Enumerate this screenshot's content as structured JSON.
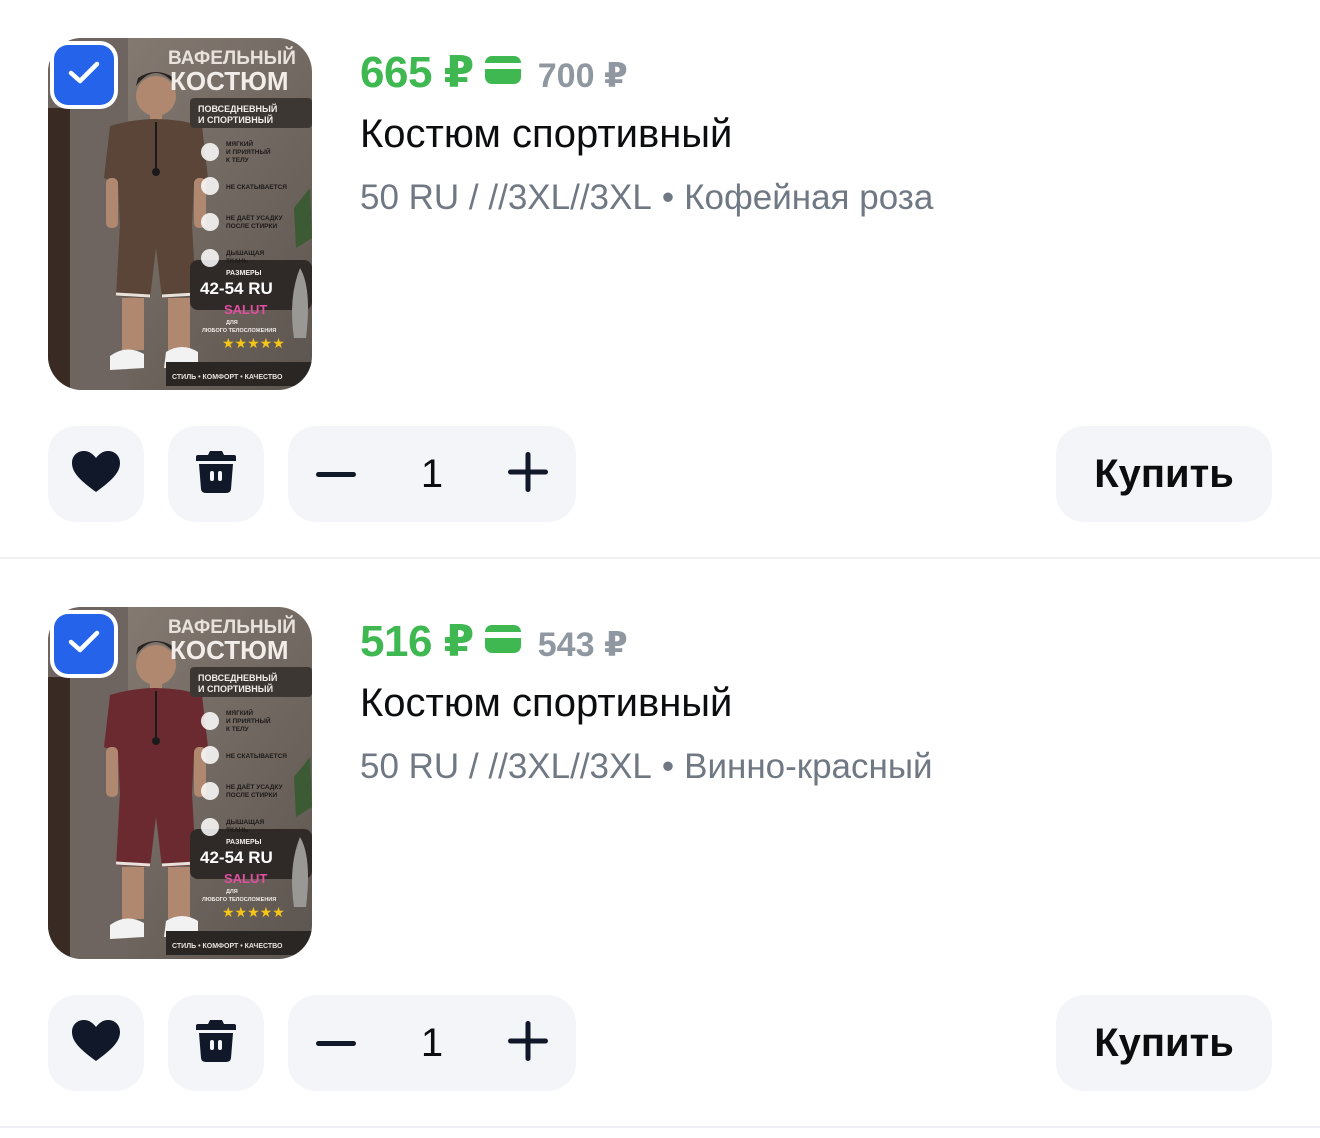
{
  "items": [
    {
      "checked": true,
      "price_current": "665 ₽",
      "price_old": "700 ₽",
      "title": "Костюм спортивный",
      "size": "50 RU / //3XL//3XL",
      "color_name": "Кофейная роза",
      "quantity": "1",
      "buy_label": "Купить",
      "suit_color": "#5a4538",
      "image_text": {
        "headline_1": "ВАФЕЛЬНЫЙ",
        "headline_2": "КОСТЮМ",
        "subtitle_1": "ПОВСЕДНЕВНЫЙ",
        "subtitle_2": "И СПОРТИВНЫЙ",
        "f1a": "МЯГКИЙ",
        "f1b": "И ПРИЯТНЫЙ",
        "f1c": "К ТЕЛУ",
        "f2": "НЕ СКАТЫВАЕТСЯ",
        "f3a": "НЕ ДАЁТ УСАДКУ",
        "f3b": "ПОСЛЕ СТИРКИ",
        "f4a": "ДЫШАЩАЯ",
        "f4b": "ТКАНЬ",
        "sizes_label": "РАЗМЕРЫ",
        "sizes_value": "42-54 RU",
        "brand": "SALUT",
        "for_any_1": "ДЛЯ",
        "for_any_2": "ЛЮБОГО ТЕЛОСЛОЖЕНИЯ",
        "bottom": "СТИЛЬ • КОМФОРТ • КАЧЕСТВО"
      }
    },
    {
      "checked": true,
      "price_current": "516 ₽",
      "price_old": "543 ₽",
      "title": "Костюм спортивный",
      "size": "50 RU / //3XL//3XL",
      "color_name": "Винно-красный",
      "quantity": "1",
      "buy_label": "Купить",
      "suit_color": "#6b2a30",
      "image_text": {
        "headline_1": "ВАФЕЛЬНЫЙ",
        "headline_2": "КОСТЮМ",
        "subtitle_1": "ПОВСЕДНЕВНЫЙ",
        "subtitle_2": "И СПОРТИВНЫЙ",
        "f1a": "МЯГКИЙ",
        "f1b": "И ПРИЯТНЫЙ",
        "f1c": "К ТЕЛУ",
        "f2": "НЕ СКАТЫВАЕТСЯ",
        "f3a": "НЕ ДАЁТ УСАДКУ",
        "f3b": "ПОСЛЕ СТИРКИ",
        "f4a": "ДЫШАЩАЯ",
        "f4b": "ТКАНЬ",
        "sizes_label": "РАЗМЕРЫ",
        "sizes_value": "42-54 RU",
        "brand": "SALUT",
        "for_any_1": "ДЛЯ",
        "for_any_2": "ЛЮБОГО ТЕЛОСЛОЖЕНИЯ",
        "bottom": "СТИЛЬ • КОМФОРТ • КАЧЕСТВО"
      }
    }
  ],
  "icons": {
    "checkbox": "check-icon",
    "payment_card": "card-icon",
    "favorite": "heart-icon",
    "delete": "trash-icon",
    "decrease": "minus-icon",
    "increase": "plus-icon"
  },
  "colors": {
    "accent_blue": "#2563eb",
    "price_green": "#3fb851",
    "old_price_gray": "#8f97a1",
    "button_bg": "#f3f5f8"
  }
}
